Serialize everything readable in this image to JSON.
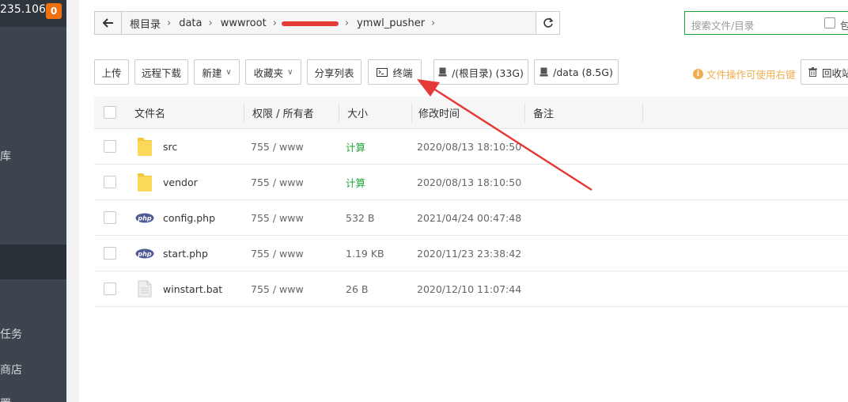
{
  "sidebar": {
    "server_ip": "235.106",
    "badge_count": "0",
    "menu_fragments": [
      "库",
      "任务",
      "商店",
      "置"
    ]
  },
  "breadcrumb": {
    "items": [
      "根目录",
      "data",
      "wwwroot",
      "ymwl_pusher"
    ]
  },
  "search": {
    "placeholder": "搜索文件/目录",
    "include_label": "包"
  },
  "toolbar": {
    "upload": "上传",
    "remote_download": "远程下载",
    "new": "新建",
    "favorites": "收藏夹",
    "share_list": "分享列表",
    "terminal": "终端",
    "disk_root": "/(根目录) (33G)",
    "disk_data": "/data (8.5G)",
    "tip": "文件操作可使用右键",
    "recycle": "回收站"
  },
  "table": {
    "headers": {
      "name": "文件名",
      "perm": "权限 / 所有者",
      "size": "大小",
      "mtime": "修改时间",
      "note": "备注"
    },
    "rows": [
      {
        "icon": "folder-icon",
        "name": "src",
        "perm": "755 / www",
        "size": "计算",
        "mtime": "2020/08/13 18:10:50"
      },
      {
        "icon": "folder-icon",
        "name": "vendor",
        "perm": "755 / www",
        "size": "计算",
        "mtime": "2020/08/13 18:10:50"
      },
      {
        "icon": "php-file-icon",
        "name": "config.php",
        "perm": "755 / www",
        "size": "532 B",
        "mtime": "2021/04/24 00:47:48"
      },
      {
        "icon": "php-file-icon",
        "name": "start.php",
        "perm": "755 / www",
        "size": "1.19 KB",
        "mtime": "2020/11/23 23:38:42"
      },
      {
        "icon": "text-file-icon",
        "name": "winstart.bat",
        "perm": "755 / www",
        "size": "26 B",
        "mtime": "2020/12/10 11:07:44"
      }
    ]
  },
  "colors": {
    "accent_green": "#20a53a",
    "sidebar_bg": "#3c444d",
    "badge_orange": "#f0700f",
    "annotation_red": "#e53935",
    "tip_orange": "#f0ad4e"
  }
}
